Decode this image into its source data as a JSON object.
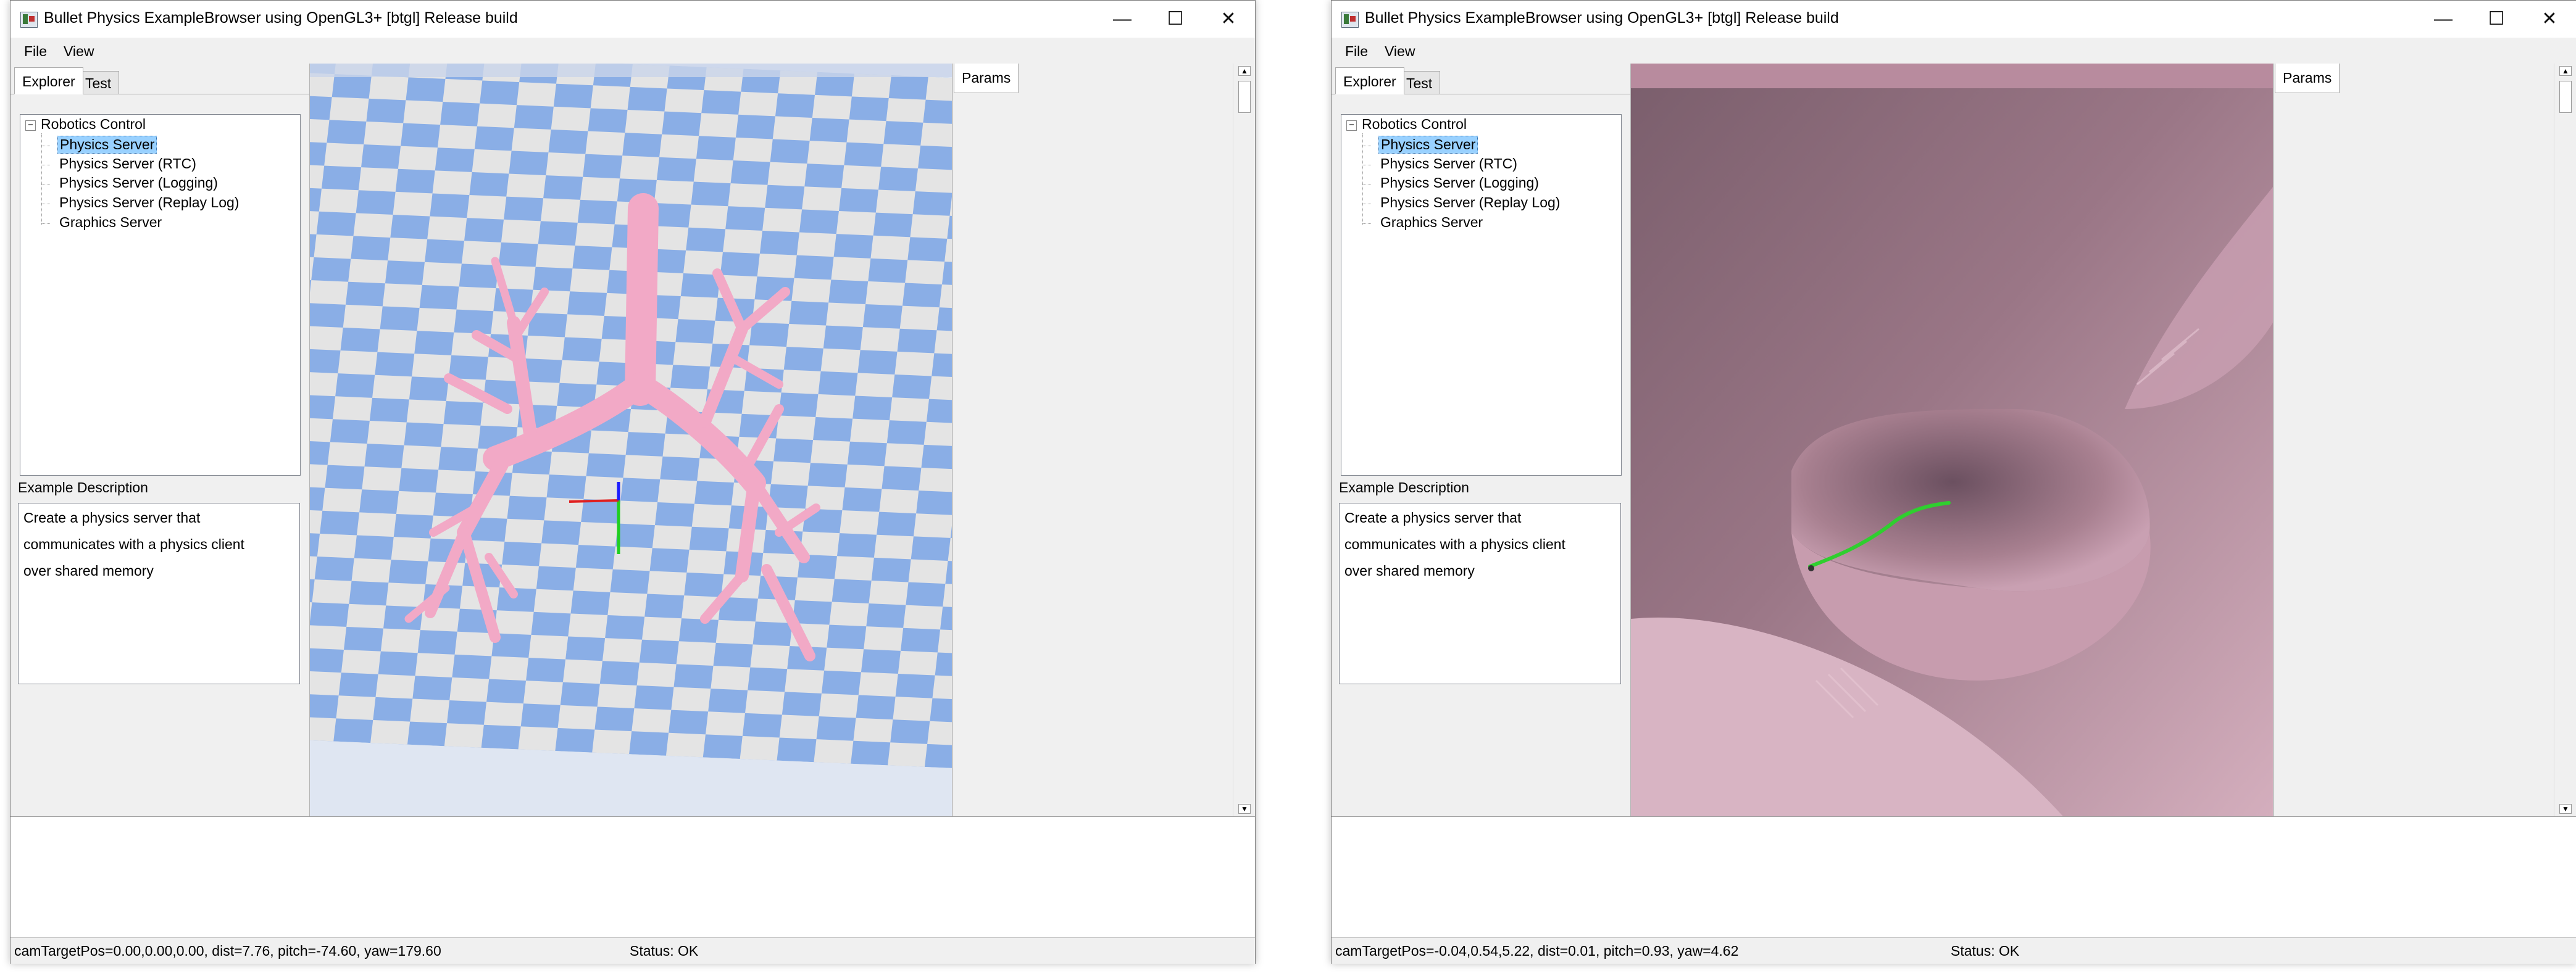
{
  "windows": [
    {
      "title": "Bullet Physics ExampleBrowser using OpenGL3+ [btgl] Release build",
      "menu": [
        "File",
        "View"
      ],
      "tabs": [
        "Explorer",
        "Test"
      ],
      "tree": {
        "root": "Robotics Control",
        "items": [
          "Physics Server",
          "Physics Server (RTC)",
          "Physics Server (Logging)",
          "Physics Server (Replay Log)",
          "Graphics Server"
        ],
        "selected_index": 0
      },
      "description_label": "Example Description",
      "description_lines": [
        "Create a physics server that",
        "communicates with a physics client",
        "over shared memory"
      ],
      "params_tab": "Params",
      "status_position": "camTargetPos=0.00,0.00,0.00, dist=7.76, pitch=-74.60, yaw=179.60",
      "status_text": "Status: OK"
    },
    {
      "title": "Bullet Physics ExampleBrowser using OpenGL3+ [btgl] Release build",
      "menu": [
        "File",
        "View"
      ],
      "tabs": [
        "Explorer",
        "Test"
      ],
      "tree": {
        "root": "Robotics Control",
        "items": [
          "Physics Server",
          "Physics Server (RTC)",
          "Physics Server (Logging)",
          "Physics Server (Replay Log)",
          "Graphics Server"
        ],
        "selected_index": 0
      },
      "description_label": "Example Description",
      "description_lines": [
        "Create a physics server that",
        "communicates with a physics client",
        "over shared memory"
      ],
      "params_tab": "Params",
      "status_position": "camTargetPos=-0.04,0.54,5.22, dist=0.01, pitch=0.93, yaw=4.62",
      "status_text": "Status: OK"
    }
  ],
  "window_controls": {
    "minimize": "—",
    "maximize": "☐",
    "close": "✕"
  },
  "icons": {
    "app": "app-icon",
    "minimize": "minimize-icon",
    "maximize": "maximize-icon",
    "close": "close-icon",
    "toggle": "tree-collapse-icon"
  },
  "colors": {
    "selection": "#99d1ff",
    "checker_blue": "#8aaee6",
    "checker_light": "#e4e4e4",
    "bronchi": "#f2a9c6",
    "airway_interior": "#b88b9e",
    "instrument_green": "#2fcf2f"
  }
}
